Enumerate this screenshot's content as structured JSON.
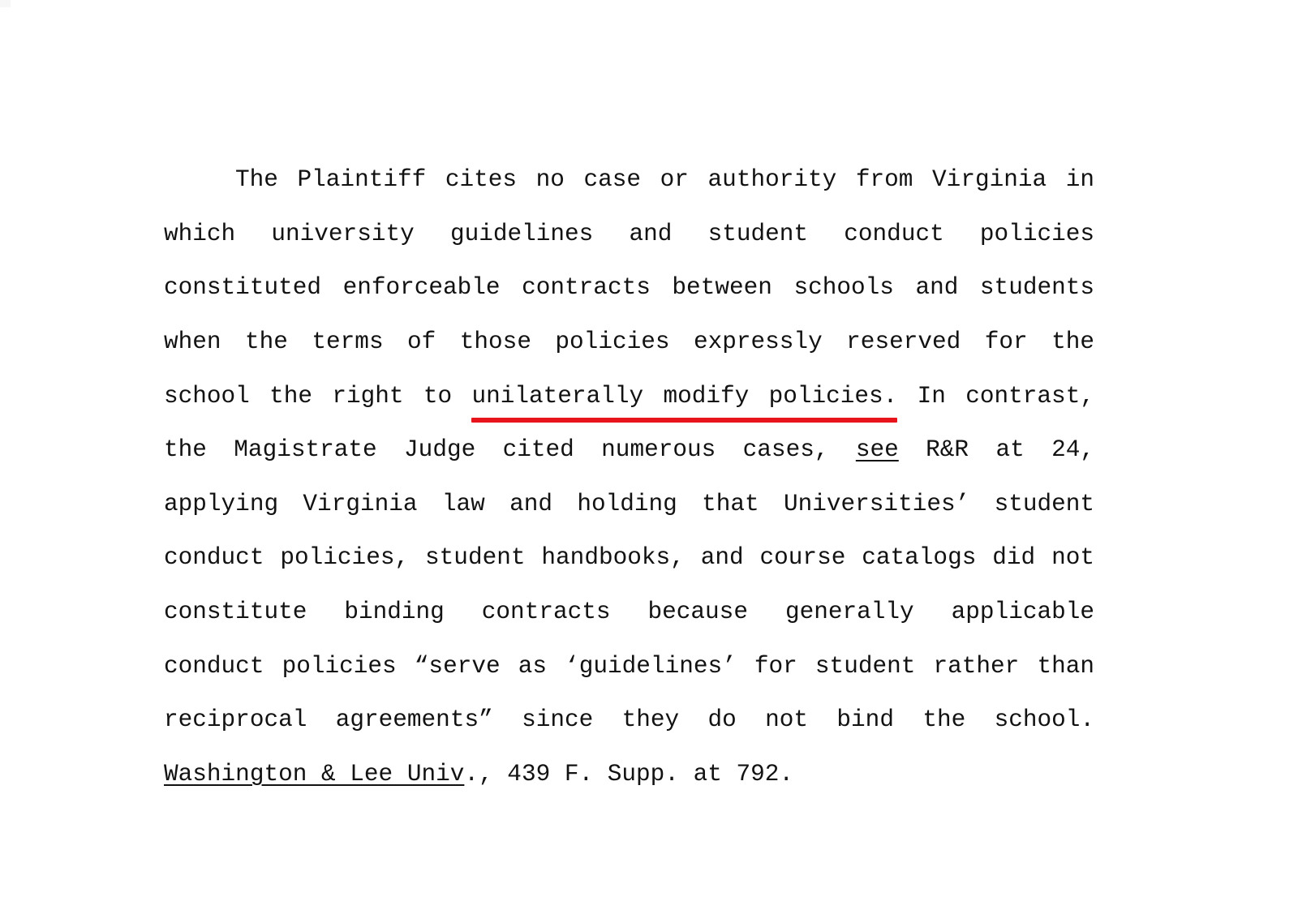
{
  "document": {
    "type": "scanned-legal-brief-excerpt",
    "page_background": "#ffffff",
    "text_color": "#121212",
    "highlight_color": "#e8141b",
    "underline_color": "#121212",
    "paragraph": {
      "first_line_indent": true,
      "justified": true,
      "full_text": "The Plaintiff cites no case or authority from Virginia in which university guidelines and student conduct policies constituted enforceable contracts between schools and students when the terms of those policies expressly reserved for the school the right to unilaterally modify policies. In contrast, the Magistrate Judge cited numerous cases, see R&R at 24, applying Virginia law and holding that Universities’ student conduct policies, student handbooks, and course catalogs did not constitute binding contracts because generally applicable conduct policies “serve as ‘guidelines’ for student rather than reciprocal agreements” since they do not bind the school. Washington & Lee Univ., 439 F. Supp. at 792."
    },
    "lines": [
      {
        "id": "line-1",
        "indent": true,
        "justified": true,
        "words": [
          "The",
          "Plaintiff",
          "cites",
          "no",
          "case",
          "or",
          "authority",
          "from",
          "Virginia",
          "in"
        ],
        "text": "The Plaintiff cites no case or authority from Virginia in"
      },
      {
        "id": "line-2",
        "indent": false,
        "justified": true,
        "words": [
          "which",
          "university",
          "guidelines",
          "and",
          "student",
          "conduct",
          "policies"
        ],
        "text": "which university guidelines and student conduct policies"
      },
      {
        "id": "line-3",
        "indent": false,
        "justified": true,
        "words": [
          "constituted",
          "enforceable",
          "contracts",
          "between",
          "schools",
          "and",
          "students"
        ],
        "text": "constituted enforceable contracts between schools and students"
      },
      {
        "id": "line-4",
        "indent": false,
        "justified": true,
        "words": [
          "when",
          "the",
          "terms",
          "of",
          "those",
          "policies",
          "expressly",
          "reserved",
          "for",
          "the"
        ],
        "text": "when the terms of those policies expressly reserved for the"
      },
      {
        "id": "line-5",
        "indent": false,
        "justified": true,
        "words": [
          "school",
          "the",
          "right",
          "to",
          "unilaterally",
          "modify",
          "policies.",
          "In",
          "contrast,"
        ],
        "text": "school the right to unilaterally modify policies. In contrast,"
      },
      {
        "id": "line-6",
        "indent": false,
        "justified": true,
        "words": [
          "the",
          "Magistrate",
          "Judge",
          "cited",
          "numerous",
          "cases,",
          "see",
          "R&R",
          "at",
          "24,"
        ],
        "text": "the Magistrate Judge cited numerous cases, see R&R at 24,"
      },
      {
        "id": "line-7",
        "indent": false,
        "justified": true,
        "words": [
          "applying",
          "Virginia",
          "law",
          "and",
          "holding",
          "that",
          "Universities’",
          "student"
        ],
        "text": "applying Virginia law and holding that Universities’ student"
      },
      {
        "id": "line-8",
        "indent": false,
        "justified": true,
        "words": [
          "conduct",
          "policies,",
          "student",
          "handbooks,",
          "and",
          "course",
          "catalogs",
          "did",
          "not"
        ],
        "text": "conduct policies, student handbooks, and course catalogs did not"
      },
      {
        "id": "line-9",
        "indent": false,
        "justified": true,
        "words": [
          "constitute",
          "binding",
          "contracts",
          "because",
          "generally",
          "applicable"
        ],
        "text": "constitute binding contracts because generally applicable"
      },
      {
        "id": "line-10",
        "indent": false,
        "justified": true,
        "words": [
          "conduct",
          "policies",
          "“serve",
          "as",
          "‘guidelines’",
          "for",
          "student",
          "rather",
          "than"
        ],
        "text": "conduct policies “serve as ‘guidelines’ for student rather than"
      },
      {
        "id": "line-11",
        "indent": false,
        "justified": true,
        "words": [
          "reciprocal",
          "agreements”",
          "since",
          "they",
          "do",
          "not",
          "bind",
          "the",
          "school."
        ],
        "text": "reciprocal agreements” since they do not bind the school."
      },
      {
        "id": "line-12",
        "indent": false,
        "justified": false,
        "words": [
          "Washington",
          "&",
          "Lee",
          "Univ.,",
          "439",
          "F.",
          "Supp.",
          "at",
          "792."
        ],
        "text": "Washington & Lee Univ., 439 F. Supp. at 792."
      }
    ],
    "annotations": {
      "red_underline": {
        "kind": "red-highlight-underline",
        "underlined_text": "unilaterally modify policies.",
        "color": "#e8141b",
        "on_line": "line-5"
      },
      "black_underlines": [
        {
          "kind": "citation-signal-underline",
          "underlined_text": "see",
          "on_line": "line-6"
        },
        {
          "kind": "case-name-underline",
          "underlined_text": "Washington & Lee Univ",
          "on_line": "line-12"
        }
      ]
    },
    "line_5_segments": {
      "pre": "school the right to ",
      "highlighted": "unilaterally modify policies.",
      "post": " In contrast,"
    },
    "line_6_segments": {
      "pre": "the Magistrate Judge cited numerous cases, ",
      "underlined": "see",
      "post": " R&R at 24,"
    },
    "line_12_segments": {
      "underlined": "Washington & Lee Univ",
      "post": "., 439 F. Supp. at 792."
    },
    "citation": {
      "case_name": "Washington & Lee Univ.",
      "reporter_volume": "439",
      "reporter": "F. Supp.",
      "pincite": "at 792."
    },
    "record_reference": {
      "label": "R&R",
      "page": "24"
    }
  }
}
